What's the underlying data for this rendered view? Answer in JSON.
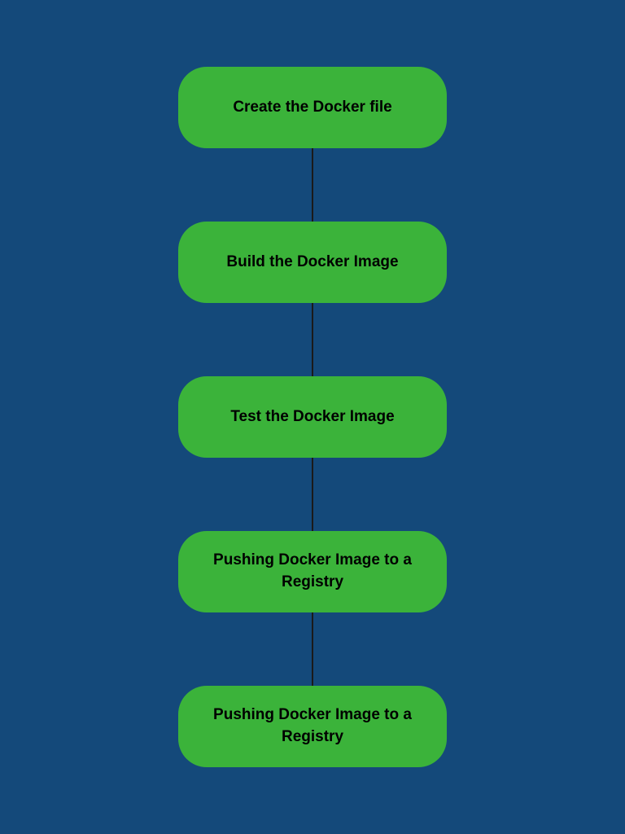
{
  "flowchart": {
    "steps": [
      {
        "label": "Create the Docker file"
      },
      {
        "label": "Build the Docker Image"
      },
      {
        "label": "Test the Docker Image"
      },
      {
        "label": "Pushing Docker Image to a Registry"
      },
      {
        "label": "Pushing Docker Image to a Registry"
      }
    ]
  },
  "colors": {
    "background": "#14497a",
    "box": "#3bb33a",
    "text": "#000000",
    "connector": "#1a1a1a"
  }
}
